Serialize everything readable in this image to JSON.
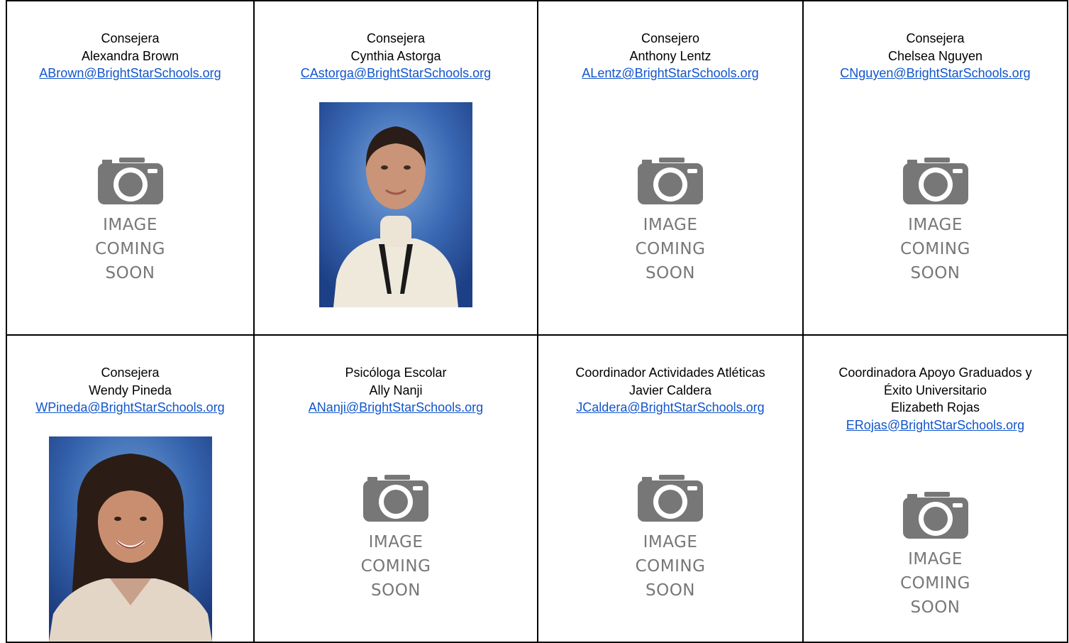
{
  "staff": [
    {
      "title": "Consejera",
      "title2": "",
      "name": "Alexandra Brown",
      "email": "ABrown@BrightStarSchools.org",
      "image": "placeholder"
    },
    {
      "title": "Consejera",
      "title2": "",
      "name": "Cynthia Astorga",
      "email": "CAstorga@BrightStarSchools.org",
      "image": "photo"
    },
    {
      "title": "Consejero",
      "title2": "",
      "name": "Anthony Lentz",
      "email": "ALentz@BrightStarSchools.org",
      "image": "placeholder"
    },
    {
      "title": "Consejera",
      "title2": "",
      "name": "Chelsea Nguyen",
      "email": "CNguyen@BrightStarSchools.org",
      "image": "placeholder"
    },
    {
      "title": "Consejera",
      "title2": "",
      "name": "Wendy Pineda",
      "email": "WPineda@BrightStarSchools.org",
      "image": "photo"
    },
    {
      "title": "Psicóloga Escolar",
      "title2": "",
      "name": "Ally Nanji",
      "email": "ANanji@BrightStarSchools.org",
      "image": "placeholder"
    },
    {
      "title": "Coordinador Actividades Atléticas",
      "title2": "",
      "name": "Javier Caldera",
      "email": "JCaldera@BrightStarSchools.org",
      "image": "placeholder"
    },
    {
      "title": "Coordinadora Apoyo Graduados y",
      "title2": "Éxito Universitario",
      "name": "Elizabeth Rojas",
      "email": "ERojas@BrightStarSchools.org",
      "image": "placeholder"
    }
  ],
  "placeholder": {
    "line1": "IMAGE",
    "line2": "COMING",
    "line3": "SOON",
    "icon": "camera-icon",
    "color": "#777777"
  },
  "colors": {
    "link": "#1155cc",
    "border": "#000000",
    "photo_backdrop": "#2f5fa8"
  }
}
